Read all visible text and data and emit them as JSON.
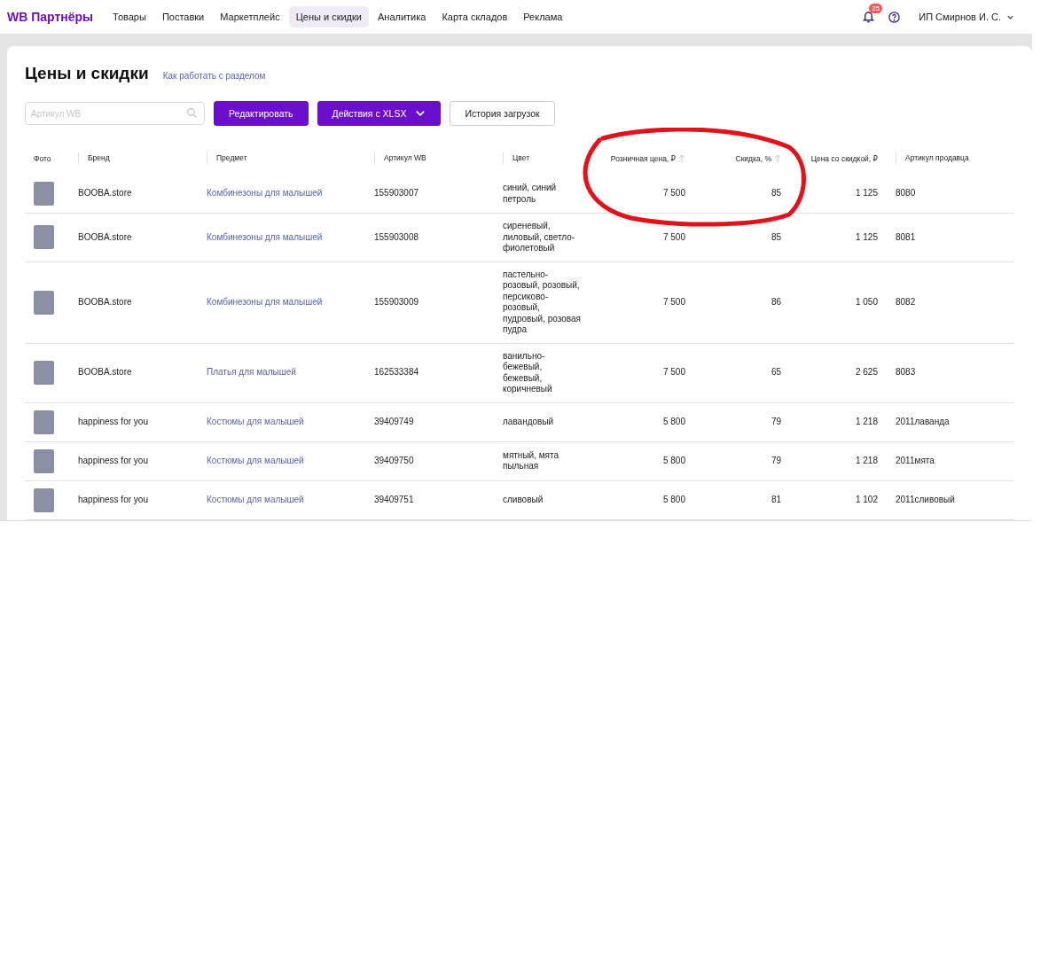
{
  "header": {
    "logo": "WB Партнёры",
    "nav": [
      {
        "label": "Товары",
        "selected": false
      },
      {
        "label": "Поставки",
        "selected": false
      },
      {
        "label": "Маркетплейс",
        "selected": false
      },
      {
        "label": "Цены и скидки",
        "selected": true
      },
      {
        "label": "Аналитика",
        "selected": false
      },
      {
        "label": "Карта складов",
        "selected": false
      },
      {
        "label": "Реклама",
        "selected": false
      }
    ],
    "notifications_badge": "25",
    "user": "ИП Смирнов И. С."
  },
  "page": {
    "title": "Цены и скидки",
    "help_link": "Как работать с разделом"
  },
  "toolbar": {
    "search": {
      "placeholder": "Артикул WB"
    },
    "buttons": [
      {
        "label": "Редактировать",
        "kind": "primary"
      },
      {
        "label": "Действия с XLSX",
        "kind": "dropdown"
      },
      {
        "label": "История загрузок",
        "kind": "outline"
      }
    ]
  },
  "table": {
    "columns": [
      {
        "label": "Фото",
        "kind": "photo",
        "sortable": false
      },
      {
        "label": "Бренд",
        "kind": "text",
        "sortable": false
      },
      {
        "label": "Предмет",
        "kind": "link",
        "sortable": false
      },
      {
        "label": "Артикул WB",
        "kind": "text",
        "sortable": false
      },
      {
        "label": "Цвет",
        "kind": "text",
        "sortable": false
      },
      {
        "label": "Розничная цена, ₽",
        "kind": "number",
        "sortable": true
      },
      {
        "label": "Скидка, %",
        "kind": "number",
        "sortable": true
      },
      {
        "label": "Цена со скидкой, ₽",
        "kind": "number",
        "sortable": false
      },
      {
        "label": "Артикул продавца",
        "kind": "text",
        "sortable": false
      }
    ],
    "rows": [
      {
        "cells": [
          "",
          "BOOBA.store",
          "Комбинезоны для малышей",
          "155903007",
          "синий, синий петроль",
          "7 500",
          "85",
          "1 125",
          "8080"
        ]
      },
      {
        "cells": [
          "",
          "BOOBA.store",
          "Комбинезоны для малышей",
          "155903008",
          "сиреневый, лиловый, светло-фиолетовый",
          "7 500",
          "85",
          "1 125",
          "8081"
        ]
      },
      {
        "cells": [
          "",
          "BOOBA.store",
          "Комбинезоны для малышей",
          "155903009",
          "пастельно-розовый, розовый, персиково-розовый, пудровый, розовая пудра",
          "7 500",
          "86",
          "1 050",
          "8082"
        ]
      },
      {
        "cells": [
          "",
          "BOOBA.store",
          "Платья для малышей",
          "162533384",
          "ванильно-бежевый, бежевый, коричневый",
          "7 500",
          "65",
          "2 625",
          "8083"
        ]
      },
      {
        "cells": [
          "",
          "happiness for you",
          "Костюмы для малышей",
          "39409749",
          "лавандовый",
          "5 800",
          "79",
          "1 218",
          "2011лаванда"
        ]
      },
      {
        "cells": [
          "",
          "happiness for you",
          "Костюмы для малышей",
          "39409750",
          "мятный, мята пыльная",
          "5 800",
          "79",
          "1 218",
          "2011мята"
        ]
      },
      {
        "cells": [
          "",
          "happiness for you",
          "Костюмы для малышей",
          "39409751",
          "сливовый",
          "5 800",
          "81",
          "1 102",
          "2011сливовый"
        ]
      }
    ]
  }
}
